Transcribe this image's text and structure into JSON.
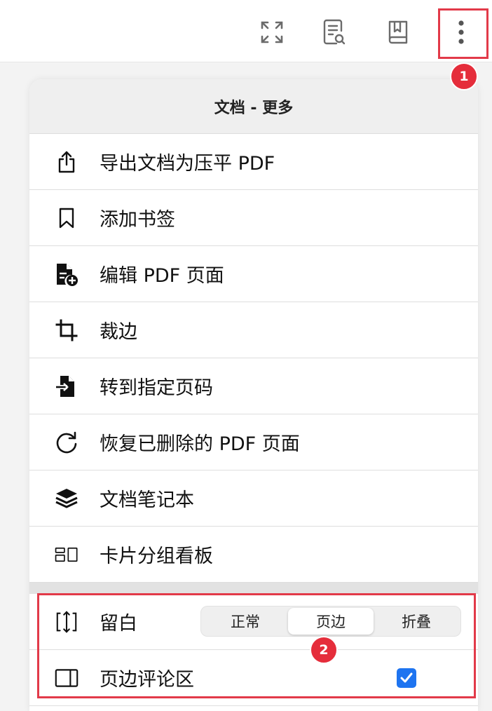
{
  "panel": {
    "title": "文档 - 更多"
  },
  "menu": [
    {
      "label": "导出文档为压平 PDF",
      "icon": "share-export-icon"
    },
    {
      "label": "添加书签",
      "icon": "bookmark-icon"
    },
    {
      "label": "编辑 PDF 页面",
      "icon": "file-add-icon"
    },
    {
      "label": "裁边",
      "icon": "crop-icon"
    },
    {
      "label": "转到指定页码",
      "icon": "file-goto-icon"
    },
    {
      "label": "恢复已删除的 PDF 页面",
      "icon": "restore-icon"
    },
    {
      "label": "文档笔记本",
      "icon": "layers-icon"
    },
    {
      "label": "卡片分组看板",
      "icon": "card-board-icon"
    }
  ],
  "margin": {
    "label": "留白",
    "options": [
      "正常",
      "页边",
      "折叠"
    ],
    "selected": "页边"
  },
  "comment_area": {
    "label": "页边评论区",
    "checked": true
  },
  "annotations": {
    "badge1": "1",
    "badge2": "2"
  },
  "colors": {
    "highlight": "#e23a49",
    "badge": "#e52d3b",
    "checkbox": "#1e74f0"
  }
}
